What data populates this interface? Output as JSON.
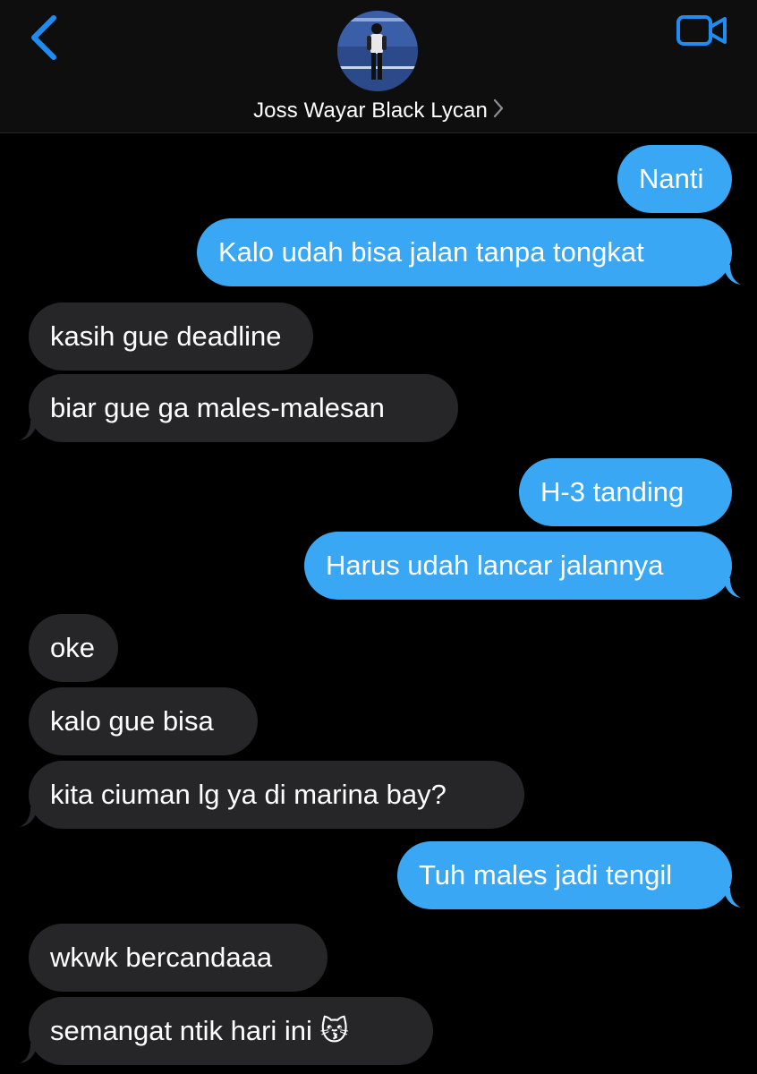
{
  "header": {
    "contact_name": "Joss Wayar Black Lycan",
    "back_icon": "chevron-left-icon",
    "video_icon": "video-camera-icon"
  },
  "colors": {
    "outgoing": "#3aa7f5",
    "incoming": "#262628",
    "accent": "#1e8cf0"
  },
  "messages": [
    {
      "dir": "out",
      "text": "Nanti"
    },
    {
      "dir": "out",
      "text": "Kalo udah bisa jalan tanpa tongkat"
    },
    {
      "dir": "in",
      "text": "kasih gue deadline"
    },
    {
      "dir": "in",
      "text": "biar gue ga males-malesan"
    },
    {
      "dir": "out",
      "text": "H-3 tanding"
    },
    {
      "dir": "out",
      "text": "Harus udah lancar jalannya"
    },
    {
      "dir": "in",
      "text": "oke"
    },
    {
      "dir": "in",
      "text": "kalo gue bisa"
    },
    {
      "dir": "in",
      "text": "kita ciuman lg ya di marina bay?"
    },
    {
      "dir": "out",
      "text": "Tuh males jadi tengil"
    },
    {
      "dir": "in",
      "text": "wkwk bercandaaa"
    },
    {
      "dir": "in",
      "text": "semangat ntik hari ini 😽"
    }
  ]
}
